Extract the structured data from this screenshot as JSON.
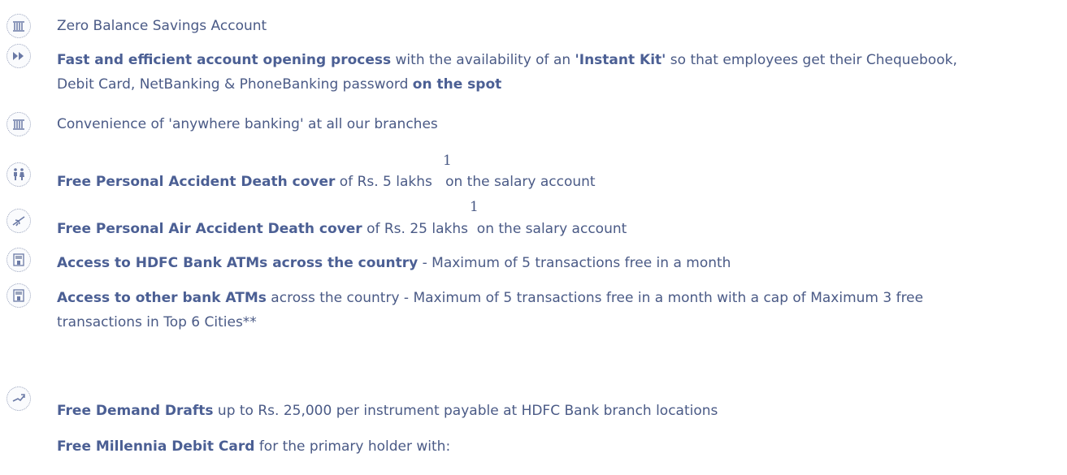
{
  "items": [
    {
      "icon": "bank-icon",
      "parts": [
        {
          "t": "Zero Balance Savings Account",
          "b": false
        }
      ]
    },
    {
      "icon": "fast-forward-icon",
      "lines": [
        [
          {
            "t": "Fast and efficient account opening process",
            "b": true
          },
          {
            "t": " with the availability of an ",
            "b": false
          },
          {
            "t": "'Instant Kit'",
            "b": true
          },
          {
            "t": " so that employees get their Chequebook,",
            "b": false
          }
        ],
        [
          {
            "t": "Debit Card, NetBanking & PhoneBanking password ",
            "b": false
          },
          {
            "t": "on the spot",
            "b": true
          }
        ]
      ]
    },
    {
      "icon": "bank-icon",
      "parts": [
        {
          "t": "Convenience of 'anywhere banking' at all our branches",
          "b": false
        }
      ]
    },
    {
      "icon": "people-icon",
      "sup": "1",
      "parts": [
        {
          "t": "Free Personal Accident Death cover",
          "b": true
        },
        {
          "t": " of Rs. 5 lakhs   on the salary account",
          "b": false
        }
      ]
    },
    {
      "icon": "airplane-icon",
      "sup": "1",
      "parts": [
        {
          "t": "Free Personal Air Accident Death cover",
          "b": true
        },
        {
          "t": " of Rs. 25 lakhs  on the salary account",
          "b": false
        }
      ]
    },
    {
      "icon": "atm-icon",
      "parts": [
        {
          "t": "Access to HDFC Bank ATMs across the country",
          "b": true
        },
        {
          "t": " - Maximum of 5 transactions free in a month",
          "b": false
        }
      ]
    },
    {
      "icon": "atm-icon",
      "lines": [
        [
          {
            "t": "Access to other bank ATMs",
            "b": true
          },
          {
            "t": " across the country - Maximum of 5 transactions free in a month with a cap of Maximum 3 free",
            "b": false
          }
        ],
        [
          {
            "t": "transactions in Top 6 Cities**",
            "b": false
          }
        ]
      ]
    },
    {
      "icon": "demand-draft-icon",
      "parts": [
        {
          "t": "Free Demand Drafts",
          "b": true
        },
        {
          "t": " up to Rs. 25,000 per instrument payable at HDFC Bank branch locations",
          "b": false
        }
      ]
    },
    {
      "icon": "",
      "parts": [
        {
          "t": "Free Millennia Debit Card",
          "b": true
        },
        {
          "t": " for the primary holder with:",
          "b": false
        }
      ]
    }
  ],
  "colors": {
    "text": "#4a5a86",
    "bold": "#4b5f94",
    "icon_border": "#9aa4bd"
  }
}
